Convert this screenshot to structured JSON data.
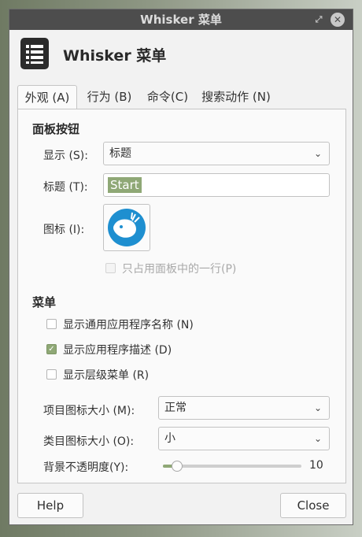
{
  "window": {
    "title": "Whisker 菜单",
    "max_glyph": "⤢",
    "close_glyph": "✕"
  },
  "header": {
    "title": "Whisker 菜单",
    "icon": "list-menu-icon"
  },
  "tabs": [
    {
      "label": "外观 (A)",
      "active": true
    },
    {
      "label": "行为 (B)",
      "active": false
    },
    {
      "label": "命令(C)",
      "active": false
    },
    {
      "label": "搜索动作 (N)",
      "active": false
    }
  ],
  "panel_button": {
    "section_title": "面板按钮",
    "display_label": "显示 (S):",
    "display_value": "标题",
    "title_label": "标题 (T):",
    "title_value": "Start",
    "icon_label": "图标 (I):",
    "icon": "xfce-mouse-icon",
    "single_row_label": "只占用面板中的一行(P)",
    "single_row_checked": false
  },
  "menu": {
    "section_title": "菜单",
    "show_generic_names_label": "显示通用应用程序名称 (N)",
    "show_generic_names_checked": false,
    "show_descriptions_label": "显示应用程序描述 (D)",
    "show_descriptions_checked": true,
    "show_hierarchy_label": "显示层级菜单 (R)",
    "show_hierarchy_checked": false,
    "item_icon_size_label": "项目图标大小 (M):",
    "item_icon_size_value": "正常",
    "category_icon_size_label": "类目图标大小 (O):",
    "category_icon_size_value": "小",
    "opacity_label": "背景不透明度(Y):",
    "opacity_value": "10",
    "opacity_fraction": 0.1
  },
  "buttons": {
    "help": "Help",
    "close": "Close"
  },
  "colors": {
    "accent": "#8fa876",
    "titlebar": "#4d4d4d",
    "icon_blue": "#1e8fd0"
  },
  "dropdown_arrow": "⌄"
}
